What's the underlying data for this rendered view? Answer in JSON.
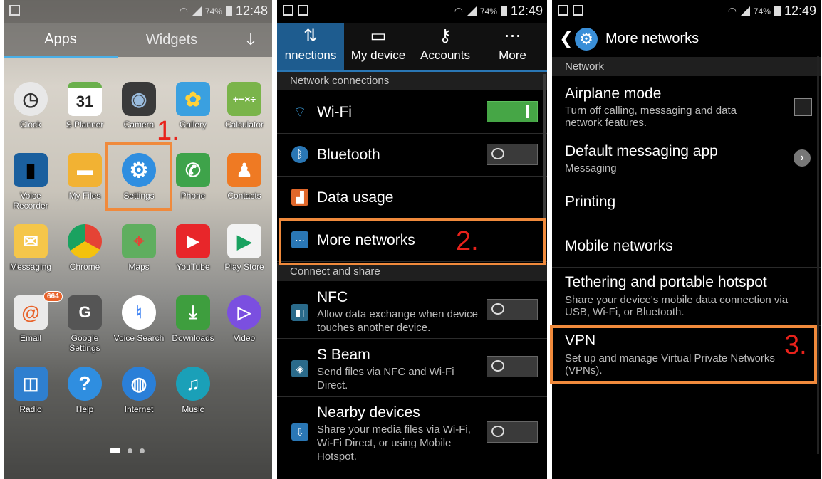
{
  "status": {
    "battery_pct": "74%",
    "time_s1": "12:48",
    "time_s2": "12:49",
    "time_s3": "12:49"
  },
  "screen1": {
    "tabs": {
      "apps": "Apps",
      "widgets": "Widgets"
    },
    "apps": [
      {
        "label": "Clock",
        "icon": "clock-icon"
      },
      {
        "label": "S Planner",
        "icon": "calendar-icon",
        "glyph": "31"
      },
      {
        "label": "Camera",
        "icon": "camera-icon"
      },
      {
        "label": "Gallery",
        "icon": "gallery-icon"
      },
      {
        "label": "Calculator",
        "icon": "calculator-icon",
        "glyph": "+−×÷"
      },
      {
        "label": "Voice Recorder",
        "icon": "microphone-icon"
      },
      {
        "label": "My Files",
        "icon": "folder-icon"
      },
      {
        "label": "Settings",
        "icon": "gear-icon"
      },
      {
        "label": "Phone",
        "icon": "phone-icon"
      },
      {
        "label": "Contacts",
        "icon": "contacts-icon"
      },
      {
        "label": "Messaging",
        "icon": "envelope-icon"
      },
      {
        "label": "Chrome",
        "icon": "chrome-icon"
      },
      {
        "label": "Maps",
        "icon": "maps-icon"
      },
      {
        "label": "YouTube",
        "icon": "youtube-icon"
      },
      {
        "label": "Play Store",
        "icon": "play-store-icon"
      },
      {
        "label": "Email",
        "icon": "email-icon",
        "badge": "664"
      },
      {
        "label": "Google Settings",
        "icon": "google-settings-icon",
        "glyph": "G"
      },
      {
        "label": "Voice Search",
        "icon": "voice-search-icon"
      },
      {
        "label": "Downloads",
        "icon": "download-icon"
      },
      {
        "label": "Video",
        "icon": "video-icon"
      },
      {
        "label": "Radio",
        "icon": "radio-icon"
      },
      {
        "label": "Help",
        "icon": "help-icon",
        "glyph": "?"
      },
      {
        "label": "Internet",
        "icon": "globe-icon"
      },
      {
        "label": "Music",
        "icon": "music-icon"
      }
    ]
  },
  "screen2": {
    "tabs": [
      {
        "label": "nnections",
        "icon": "connections-icon"
      },
      {
        "label": "My device",
        "icon": "device-icon"
      },
      {
        "label": "Accounts",
        "icon": "key-icon"
      },
      {
        "label": "More",
        "icon": "more-icon"
      }
    ],
    "section_network": "Network connections",
    "wifi": "Wi-Fi",
    "bluetooth": "Bluetooth",
    "data_usage": "Data usage",
    "more_networks": "More networks",
    "section_share": "Connect and share",
    "nfc": {
      "title": "NFC",
      "sub": "Allow data exchange when device touches another device."
    },
    "sbeam": {
      "title": "S Beam",
      "sub": "Send files via NFC and Wi-Fi Direct."
    },
    "nearby": {
      "title": "Nearby devices",
      "sub": "Share your media files via Wi-Fi, Wi-Fi Direct, or using Mobile Hotspot."
    }
  },
  "screen3": {
    "title": "More networks",
    "section": "Network",
    "airplane": {
      "title": "Airplane mode",
      "sub": "Turn off calling, messaging and data network features."
    },
    "messaging": {
      "title": "Default messaging app",
      "sub": "Messaging"
    },
    "printing": "Printing",
    "mobile": "Mobile networks",
    "tethering": {
      "title": "Tethering and portable hotspot",
      "sub": "Share your device's mobile data connection via USB, Wi-Fi, or Bluetooth."
    },
    "vpn": {
      "title": "VPN",
      "sub": "Set up and manage Virtual Private Networks (VPNs)."
    }
  },
  "annotations": {
    "step1": "1.",
    "step2": "2.",
    "step3": "3.",
    "color": "#f08a3c",
    "number_color": "#e8221b"
  },
  "colors": {
    "accent_blue": "#2a77b5",
    "toggle_on": "#46a646"
  }
}
